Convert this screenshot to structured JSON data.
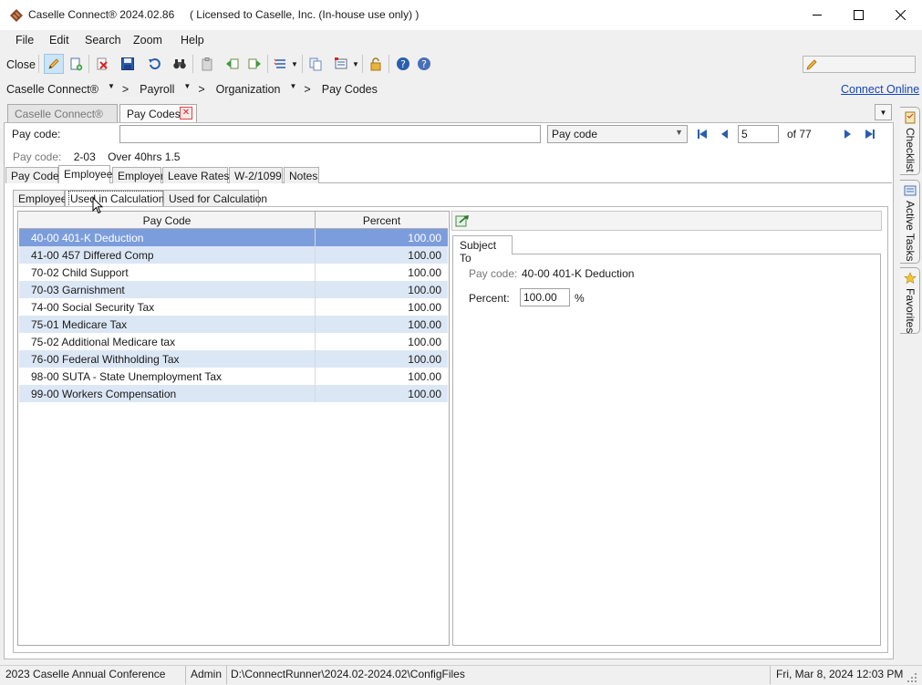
{
  "window": {
    "title": "Caselle Connect® 2024.02.86     ( Licensed to Caselle, Inc. (In-house use only) )"
  },
  "menu": [
    "File",
    "Edit",
    "Search",
    "Zoom",
    "Help"
  ],
  "toolbar": {
    "close_label": "Close",
    "buttons": [
      "edit-pencil",
      "new-document",
      "delete",
      "save",
      "undo",
      "find",
      "paste",
      "move-left",
      "move-right",
      "list-options",
      "copy",
      "view-options",
      "lock",
      "help",
      "context-help"
    ]
  },
  "breadcrumb": {
    "items": [
      "Caselle Connect®",
      "Payroll",
      "Organization",
      "Pay Codes"
    ],
    "separator": ">",
    "connect_online": "Connect Online"
  },
  "doc_tabs": {
    "home": "Caselle Connect®",
    "active": "Pay Codes"
  },
  "record_nav": {
    "field_label": "Pay code:",
    "field_value": "",
    "sort_by": "Pay code",
    "record_number": "5",
    "record_total": "of 77"
  },
  "info": {
    "label": "Pay code:",
    "code": "2-03",
    "description": "Over 40hrs 1.5"
  },
  "section_tabs": [
    "Pay Code",
    "Employee",
    "Employer",
    "Leave Rates",
    "W-2/1099",
    "Notes"
  ],
  "sub_tabs": [
    "Employee",
    "Used in Calculations",
    "Used for Calculation"
  ],
  "grid": {
    "columns": [
      "Pay Code",
      "Percent"
    ],
    "rows": [
      {
        "code": "40-00 401-K Deduction",
        "percent": "100.00"
      },
      {
        "code": "41-00 457 Differed Comp",
        "percent": "100.00"
      },
      {
        "code": "70-02 Child Support",
        "percent": "100.00"
      },
      {
        "code": "70-03 Garnishment",
        "percent": "100.00"
      },
      {
        "code": "74-00 Social Security Tax",
        "percent": "100.00"
      },
      {
        "code": "75-01 Medicare Tax",
        "percent": "100.00"
      },
      {
        "code": "75-02 Additional Medicare tax",
        "percent": "100.00"
      },
      {
        "code": "76-00 Federal Withholding Tax",
        "percent": "100.00"
      },
      {
        "code": "98-00 SUTA - State Unemployment Tax",
        "percent": "100.00"
      },
      {
        "code": "99-00 Workers Compensation",
        "percent": "100.00"
      }
    ]
  },
  "detail": {
    "tab": "Subject To",
    "paycode_label": "Pay code:",
    "paycode_value": "40-00 401-K Deduction",
    "percent_label": "Percent:",
    "percent_value": "100.00",
    "percent_sign": "%"
  },
  "side_tabs": [
    "Checklist",
    "Active Tasks",
    "Favorites"
  ],
  "status": {
    "conference": "2023 Caselle Annual Conference",
    "user": "Admin",
    "path": "D:\\ConnectRunner\\2024.02-2024.02\\ConfigFiles",
    "datetime": "Fri, Mar 8, 2024 12:03 PM"
  },
  "colors": {
    "selected_row": "#7c9ddc",
    "alt_row": "#dce7f6",
    "link": "#1447b8"
  }
}
